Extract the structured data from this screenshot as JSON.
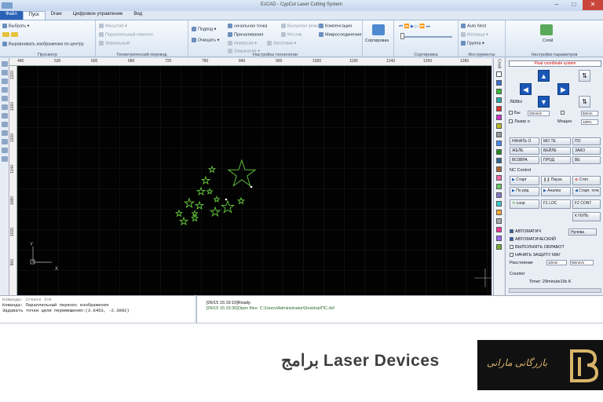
{
  "window": {
    "title": "EzCAD - CypCut Laser Cutting System",
    "buttons": [
      "–",
      "□",
      "✕"
    ]
  },
  "ribbon": {
    "tabs": [
      "Файл",
      "Пуск",
      "Draw",
      "Цифровое управление",
      "Вид"
    ],
    "active_tab": "Пуск",
    "groups": [
      {
        "label": "Просмотр",
        "items": [
          "Выбрать",
          "Выравнивать изображения по центру"
        ]
      },
      {
        "label": "Геометрический перевод",
        "items": [
          "Масштаб",
          "Параллельный перенос",
          "Зеркальный"
        ]
      },
      {
        "label": "Настройка технологии",
        "items": [
          "Подвод",
          "Очищать",
          "начальная точка",
          "Выпуклая резка",
          "Компенсация",
          "Причаливания",
          "Мостик",
          "Микросоединение",
          "Инверсия",
          "Заготовки",
          "Замыкание"
        ]
      },
      {
        "label": "Сортировка",
        "items": [
          "Сортировка"
        ]
      },
      {
        "label": "Инструменты",
        "items": [
          "Auto Nest",
          "Матрица",
          "Группа"
        ]
      },
      {
        "label": "Настройки параметров",
        "items": [
          "Слой"
        ]
      }
    ]
  },
  "ruler": {
    "h_ticks": [
      "480",
      "530",
      "600",
      "680",
      "720",
      "780",
      "840",
      "900",
      "1000",
      "1180",
      "1240",
      "1260",
      "1280"
    ],
    "v_ticks": [
      "1320",
      "1260",
      "1200",
      "1140",
      "1080",
      "1020",
      "960"
    ]
  },
  "canvas": {
    "origin_labels": {
      "x": "X",
      "y": "Y"
    }
  },
  "layers_panel": {
    "label": "Слой",
    "colors": [
      "#ffffff",
      "#3b6fd4",
      "#33bb33",
      "#22aaaa",
      "#dd3333",
      "#cc33cc",
      "#bbbb22",
      "#999999",
      "#4488ff",
      "#228822",
      "#336699",
      "#aa6633",
      "#ff66aa",
      "#66cc66",
      "#8877cc",
      "#33cccc",
      "#ffaa33",
      "#aaaaaa",
      "#ff3399",
      "#9966ff",
      "#77aa33"
    ]
  },
  "control_panel": {
    "coordinate_system": "Float coordinate system",
    "left_label": "ЛЕВЫ",
    "right_label": "ПРАВЫ",
    "speed_label": "Бы",
    "speed_value": "20mm/s",
    "step_value": "50mm",
    "laser_label": "Лазер о",
    "power_label": "Мощно",
    "power_value": "100%",
    "row1": [
      "НАЧАТЬ О",
      "МО ТЕ",
      "ПО"
    ],
    "row2": [
      "ЖЕЛЕ",
      "ВЕЙЛЕ",
      "ЗАКО"
    ],
    "row3": [
      "ВОЗВРА",
      "ПРОД",
      "ВЕ"
    ],
    "nc_control": "NC Control",
    "start_label": "Старт",
    "pause_label": "Пауза",
    "stop_label": "Стоп",
    "trace_label": "По ряд",
    "simulate_label": "Анализ",
    "back_label": "Старт. точк",
    "loop_label": "Loop",
    "f1_label": "F1 LOC",
    "f2_label": "F2 CONT",
    "speed_more": "К НУЛЬ",
    "checkboxes": [
      {
        "label": "АВТОМАТИЧ",
        "checked": true
      },
      {
        "label": "АВТОМАТИЧЕСКИЙ",
        "checked": true
      },
      {
        "label": "ВЫПОЛНЯТЬ ОБРАБОТ",
        "checked": false
      },
      {
        "label": "НАЧАТЬ ЗАЩИТУ МАГ",
        "checked": false
      }
    ],
    "zero_label": "Нулева",
    "distance_label": "Расстояние",
    "distance_value": "10mm",
    "speed2_value": "50mm/s",
    "counter_label": "Counter",
    "timer_text": "Timer: 29minute19s K"
  },
  "command_log": {
    "lines": [
      "Команда: Create Ink",
      "Команда: Параллельный перенос изображения",
      "Задавать точки цели перемещения:(3.6453, -2.3092)"
    ]
  },
  "message_log": {
    "lines": [
      "[06/15 15:19:10]Ready.",
      "[06/15 15:19:30]Open files: C:\\Users\\Administrator\\Desktop\\ПС.dxf"
    ]
  },
  "banner": {
    "title": "برامج Laser Devices",
    "brand_name": "بازرگانی مارانی"
  }
}
